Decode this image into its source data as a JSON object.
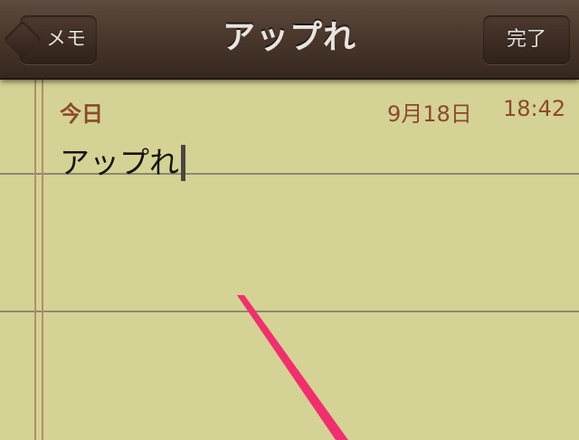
{
  "navbar": {
    "title": "アップれ",
    "back_label": "メモ",
    "done_label": "完了"
  },
  "note": {
    "date_label": "今日",
    "date": "9月18日",
    "time": "18:42",
    "body": "アップれ"
  },
  "colors": {
    "paper": "#d5d295",
    "rule_line": "#8a8970",
    "margin_line": "#b08f6a",
    "date_text": "#8b4a2c",
    "navbar": "#4a382d",
    "annotation_arrow": "#f0306e"
  }
}
